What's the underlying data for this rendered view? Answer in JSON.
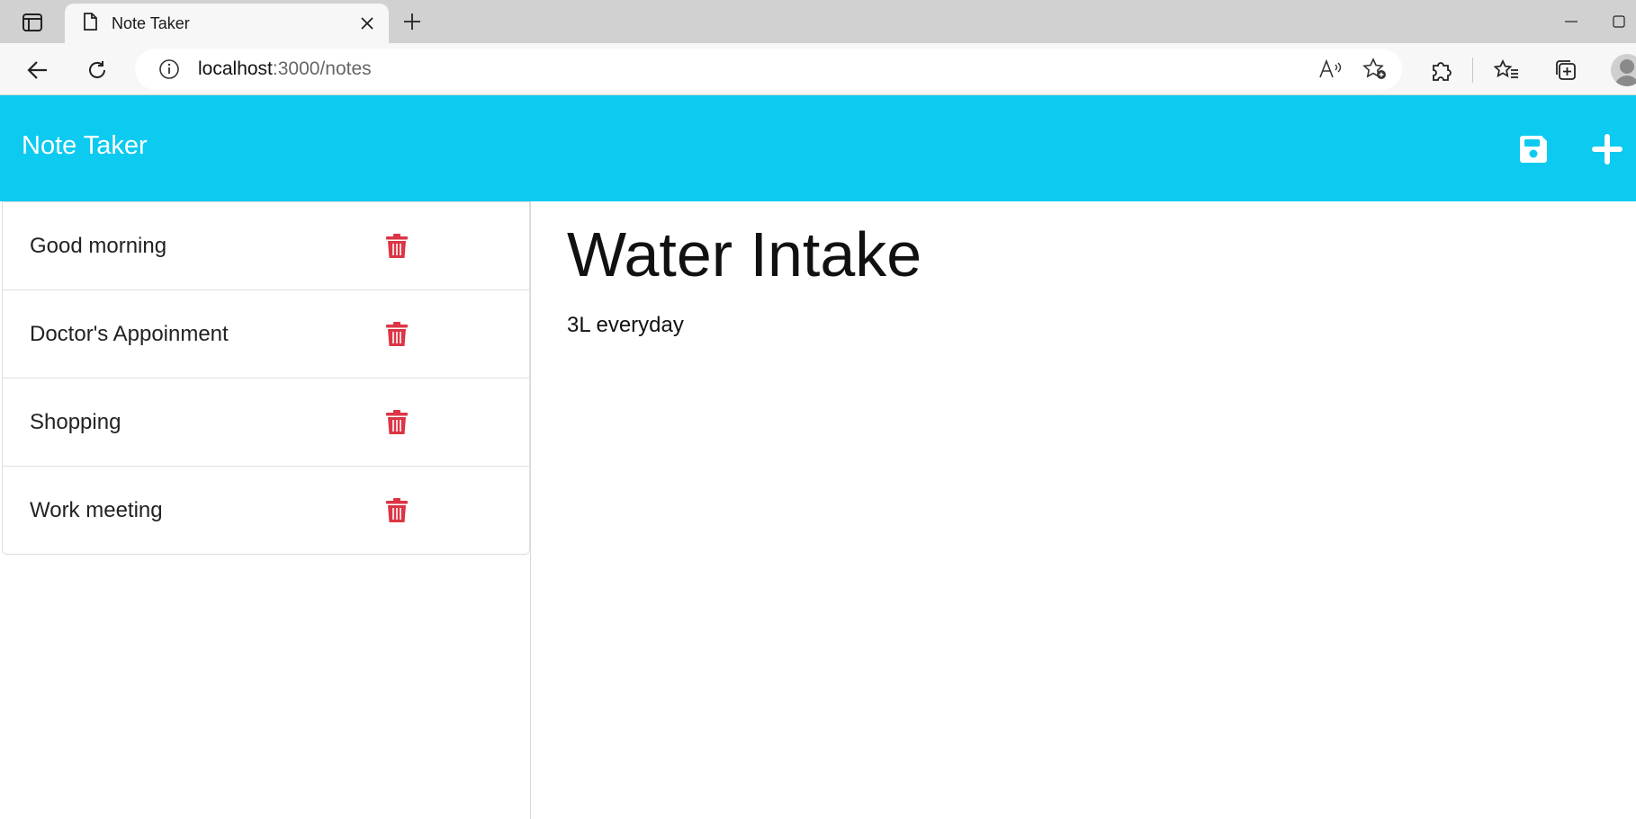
{
  "browser": {
    "tab_title": "Note Taker",
    "address_host": "localhost",
    "address_path": ":3000/notes"
  },
  "app": {
    "brand": "Note Taker",
    "accent_color": "#0dcaf0",
    "delete_color": "#dc3545"
  },
  "notes": [
    {
      "title": "Good morning"
    },
    {
      "title": "Doctor's Appoinment"
    },
    {
      "title": "Shopping"
    },
    {
      "title": "Work meeting"
    }
  ],
  "active_note": {
    "title": "Water Intake",
    "text": "3L everyday"
  },
  "icons": {
    "tab_actions": "tab-actions-icon",
    "page": "page-icon",
    "close": "close-icon",
    "new_tab": "plus-icon",
    "back": "back-arrow-icon",
    "refresh": "refresh-icon",
    "info": "info-icon",
    "read_aloud": "read-aloud-icon",
    "favorite": "add-favorite-icon",
    "extensions": "puzzle-icon",
    "favorites": "favorites-icon",
    "collections": "collections-icon",
    "save": "floppy-disk-icon",
    "new_note": "plus-icon",
    "delete": "trash-icon"
  }
}
